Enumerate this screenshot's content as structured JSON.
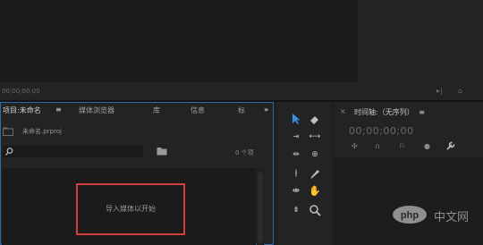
{
  "source_monitor": {
    "timecode": "00;00;00;00",
    "icons": [
      "export-frame-icon",
      "settings-icon"
    ]
  },
  "project_panel": {
    "tabs": [
      {
        "label": "项目:未命名",
        "active": true
      },
      {
        "label": "≡",
        "active": true
      },
      {
        "label": "媒体浏览器",
        "active": false
      },
      {
        "label": "库",
        "active": false
      },
      {
        "label": "信息",
        "active": false
      },
      {
        "label": "标",
        "active": false
      }
    ],
    "overflow": "»",
    "project_file": "未命名.prproj",
    "search_placeholder": "",
    "item_count": "0 个项",
    "import_hint": "导入媒体以开始"
  },
  "tools": {
    "left": [
      "selection-tool",
      "ripple-edit-tool",
      "razor-tool",
      "slip-tool",
      "pen-tool",
      "hand-tool"
    ],
    "right": [
      "track-select-tool",
      "rolling-edit-tool",
      "rate-stretch-tool",
      "slide-tool",
      "type-tool",
      "zoom-tool"
    ]
  },
  "timeline_panel": {
    "title": "时间轴:（无序列）",
    "menu": "≡",
    "timecode": "00;00;00;00"
  },
  "watermark": {
    "text": "中文网",
    "logo_text": "php"
  }
}
